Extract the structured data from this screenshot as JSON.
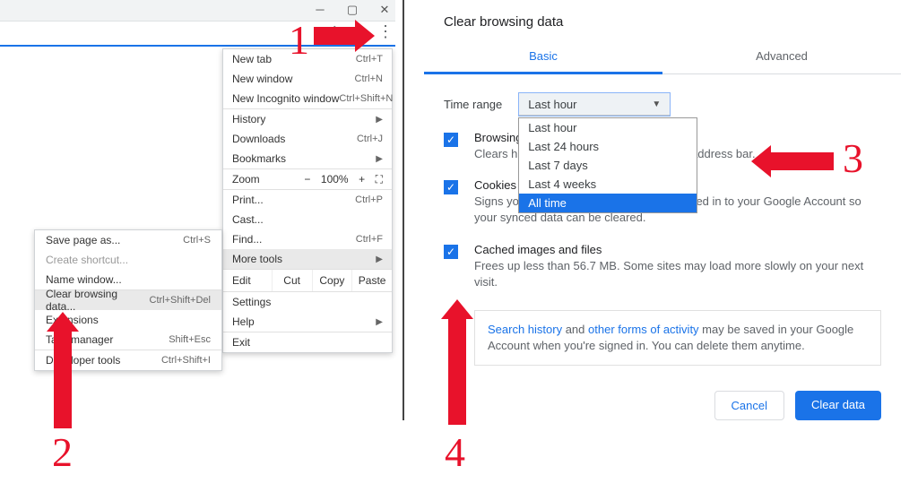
{
  "annotations": {
    "n1": "1",
    "n2": "2",
    "n3": "3",
    "n4": "4"
  },
  "window": {
    "min_caption": "Minimize",
    "max_caption": "Maximize",
    "close_caption": "Close"
  },
  "main_menu": {
    "new_tab": {
      "label": "New tab",
      "short": "Ctrl+T"
    },
    "new_window": {
      "label": "New window",
      "short": "Ctrl+N"
    },
    "incognito": {
      "label": "New Incognito window",
      "short": "Ctrl+Shift+N"
    },
    "history": {
      "label": "History"
    },
    "downloads": {
      "label": "Downloads",
      "short": "Ctrl+J"
    },
    "bookmarks": {
      "label": "Bookmarks"
    },
    "zoom": {
      "label": "Zoom",
      "value": "100%"
    },
    "print": {
      "label": "Print...",
      "short": "Ctrl+P"
    },
    "cast": {
      "label": "Cast..."
    },
    "find": {
      "label": "Find...",
      "short": "Ctrl+F"
    },
    "more_tools": {
      "label": "More tools"
    },
    "edit": {
      "label": "Edit",
      "cut": "Cut",
      "copy": "Copy",
      "paste": "Paste"
    },
    "settings": {
      "label": "Settings"
    },
    "help": {
      "label": "Help"
    },
    "exit": {
      "label": "Exit"
    }
  },
  "more_tools_menu": {
    "save_page": {
      "label": "Save page as...",
      "short": "Ctrl+S"
    },
    "create_shortcut": {
      "label": "Create shortcut..."
    },
    "name_window": {
      "label": "Name window..."
    },
    "clear_data": {
      "label": "Clear browsing data...",
      "short": "Ctrl+Shift+Del"
    },
    "extensions": {
      "label": "Extensions"
    },
    "task_manager": {
      "label": "Task manager",
      "short": "Shift+Esc"
    },
    "dev_tools": {
      "label": "Developer tools",
      "short": "Ctrl+Shift+I"
    }
  },
  "dialog": {
    "title": "Clear browsing data",
    "tabs": {
      "basic": "Basic",
      "advanced": "Advanced"
    },
    "time_range_label": "Time range",
    "combo_selected": "Last hour",
    "combo_options": [
      "Last hour",
      "Last 24 hours",
      "Last 7 days",
      "Last 4 weeks",
      "All time"
    ],
    "browsing": {
      "title": "Browsing history",
      "desc": "Clears history and autocompletions in the address bar."
    },
    "cookies": {
      "title": "Cookies and other site data",
      "desc": "Signs you out of most sites. You'll stay signed in to your Google Account so your synced data can be cleared."
    },
    "cache": {
      "title": "Cached images and files",
      "desc": "Frees up less than 56.7 MB. Some sites may load more slowly on your next visit."
    },
    "info": {
      "link1": "Search history",
      "mid": " and ",
      "link2": "other forms of activity",
      "rest": " may be saved in your Google Account when you're signed in. You can delete them anytime."
    },
    "buttons": {
      "cancel": "Cancel",
      "clear": "Clear data"
    }
  }
}
